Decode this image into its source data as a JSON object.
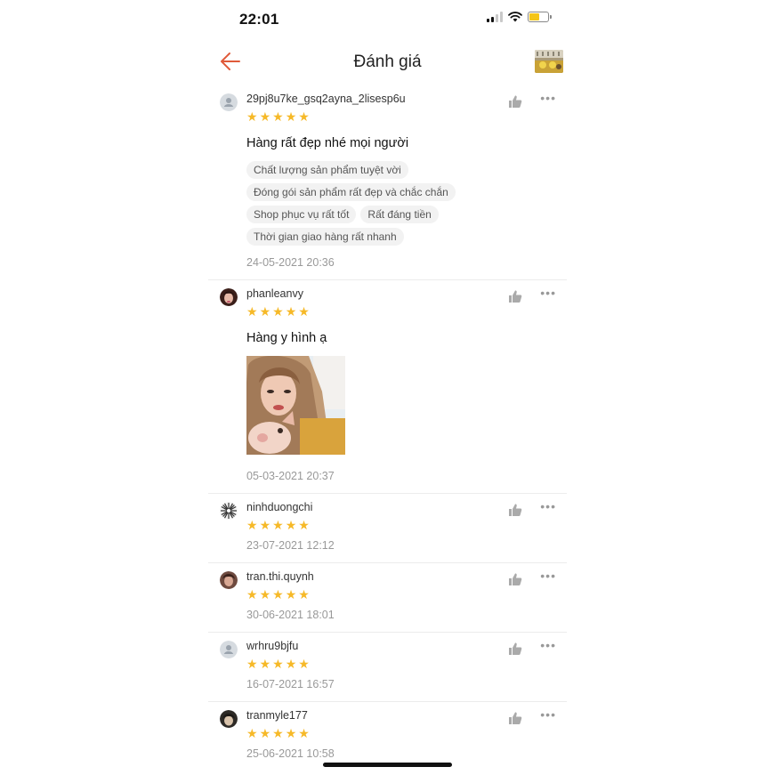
{
  "status_bar": {
    "time": "22:01"
  },
  "header": {
    "title": "Đánh giá"
  },
  "reviews": [
    {
      "username": "29pj8u7ke_gsq2ayna_2lisesp6u",
      "rating": 5,
      "comment": "Hàng rất đẹp nhé mọi người",
      "tags": [
        "Chất lượng sản phẩm tuyệt vời",
        "Đóng gói sản phẩm rất đẹp và chắc chắn",
        "Shop phục vụ rất tốt",
        "Rất đáng tiền",
        "Thời gian giao hàng rất nhanh"
      ],
      "date": "24-05-2021 20:36"
    },
    {
      "username": "phanleanvy",
      "rating": 5,
      "comment": "Hàng y hình ạ",
      "date": "05-03-2021 20:37"
    },
    {
      "username": "ninhduongchi",
      "rating": 5,
      "date": "23-07-2021 12:12"
    },
    {
      "username": "tran.thi.quynh",
      "rating": 5,
      "date": "30-06-2021 18:01"
    },
    {
      "username": "wrhru9bjfu",
      "rating": 5,
      "date": "16-07-2021 16:57"
    },
    {
      "username": "tranmyle177",
      "rating": 5,
      "date": "25-06-2021 10:58"
    }
  ],
  "colors": {
    "star": "#f6b928",
    "back_arrow": "#e05a3a",
    "separator": "#ececec"
  }
}
